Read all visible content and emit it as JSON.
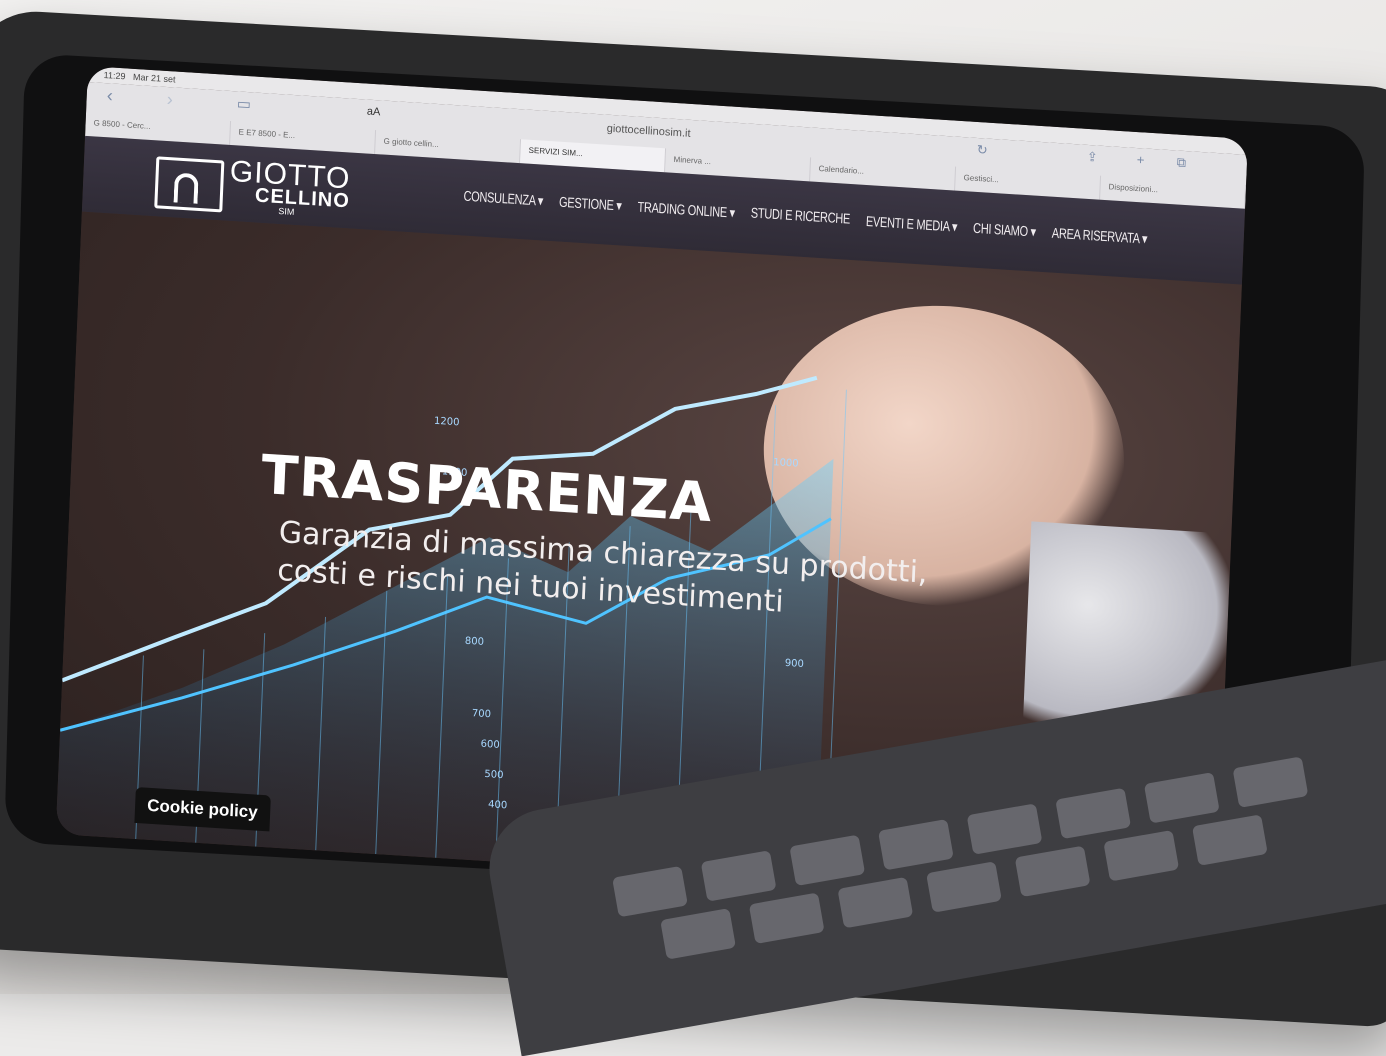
{
  "status": {
    "time": "11:29",
    "date": "Mar 21 set"
  },
  "browser": {
    "aa_label": "aA",
    "url": "giottocellinosim.it",
    "tabs": [
      "G 8500 - Cerc...",
      "E E7 8500 - E...",
      "G giotto cellin...",
      "SERVIZI SIM...",
      "Minerva ...",
      "Calendario...",
      "Gestisci...",
      "Disposizioni..."
    ]
  },
  "site": {
    "logo": {
      "line1": "GIOTTO",
      "line2": "CELLINO",
      "line3": "SIM"
    },
    "menu": [
      "CONSULENZA ▾",
      "GESTIONE ▾",
      "TRADING ONLINE ▾",
      "STUDI E RICERCHE",
      "EVENTI E MEDIA ▾",
      "CHI SIAMO ▾",
      "AREA RISERVATA ▾"
    ]
  },
  "hero": {
    "title": "TRASPARENZA",
    "subtitle_line1": "Garanzia di massima chiarezza su prodotti,",
    "subtitle_line2": "costi e rischi nei tuoi investimenti",
    "chart_ticks": [
      "1200",
      "1100",
      "1000",
      "900",
      "800",
      "700",
      "600",
      "500",
      "400"
    ]
  },
  "cookie": {
    "label": "Cookie policy"
  },
  "colors": {
    "header_bg": "#2f2b36",
    "hero_bg": "#3b2c2a",
    "glow": "#4fc3ff"
  }
}
